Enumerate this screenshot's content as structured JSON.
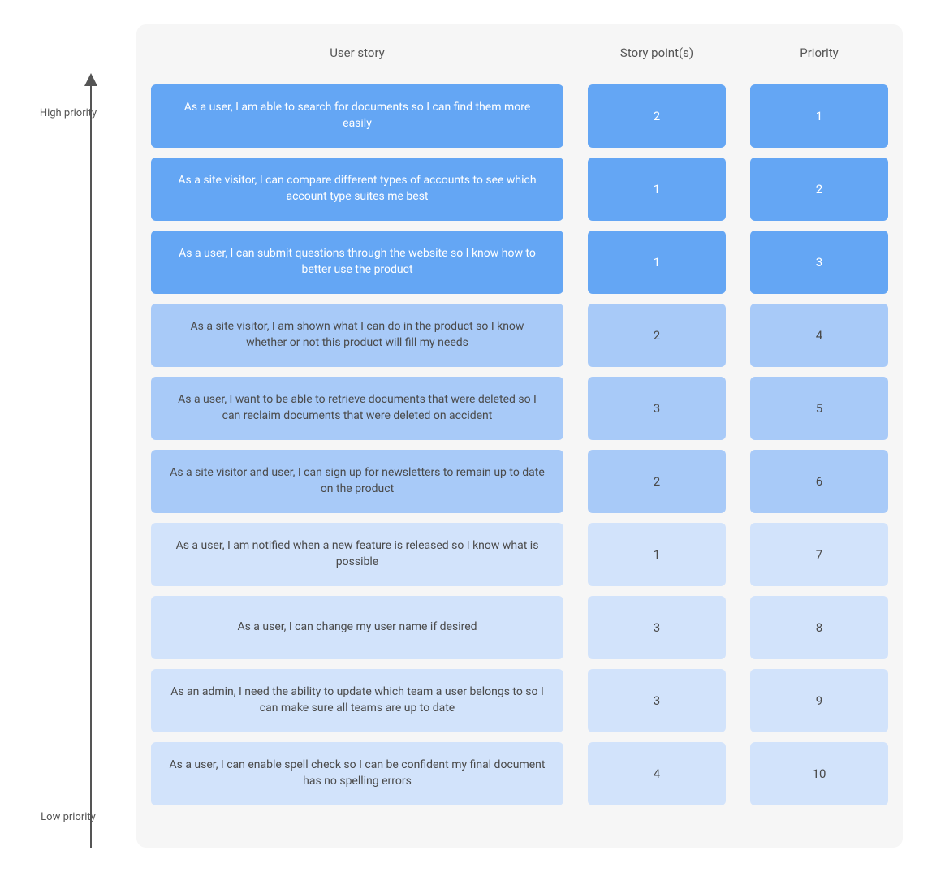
{
  "axis": {
    "high_label": "High priority",
    "low_label": "Low priority"
  },
  "headers": {
    "story": "User story",
    "points": "Story point(s)",
    "priority": "Priority"
  },
  "tiers": {
    "high": {
      "color": "#64a6f4",
      "text": "#ffffff"
    },
    "mid": {
      "color": "#a8caf8",
      "text": "#4a4a4a"
    },
    "low": {
      "color": "#d2e3fb",
      "text": "#4a4a4a"
    }
  },
  "rows": [
    {
      "story": "As a user, I am able to search for documents so I can find them more easily",
      "points": 2,
      "priority": 1,
      "tier": "high"
    },
    {
      "story": "As a site visitor, I can compare different types of accounts to see which account type suites me best",
      "points": 1,
      "priority": 2,
      "tier": "high"
    },
    {
      "story": "As a user, I can submit questions through the website so I know how to better use the product",
      "points": 1,
      "priority": 3,
      "tier": "high"
    },
    {
      "story": "As a site visitor, I am shown what I can do in the product so I know whether or not this product will fill my needs",
      "points": 2,
      "priority": 4,
      "tier": "mid"
    },
    {
      "story": "As a user, I want to be able to retrieve documents that were deleted so I can reclaim documents that were deleted on accident",
      "points": 3,
      "priority": 5,
      "tier": "mid"
    },
    {
      "story": "As a site visitor and user, I can sign up for newsletters to remain up to date on the product",
      "points": 2,
      "priority": 6,
      "tier": "mid"
    },
    {
      "story": "As a user, I am notified when a new feature is released so I know what is possible",
      "points": 1,
      "priority": 7,
      "tier": "low"
    },
    {
      "story": "As a user, I can change my user name if desired",
      "points": 3,
      "priority": 8,
      "tier": "low"
    },
    {
      "story": "As an admin, I need the ability to update which team a user belongs to so I can make sure all teams are up to date",
      "points": 3,
      "priority": 9,
      "tier": "low"
    },
    {
      "story": "As a user, I can enable spell check so I can be confident my final document has no spelling errors",
      "points": 4,
      "priority": 10,
      "tier": "low"
    }
  ]
}
